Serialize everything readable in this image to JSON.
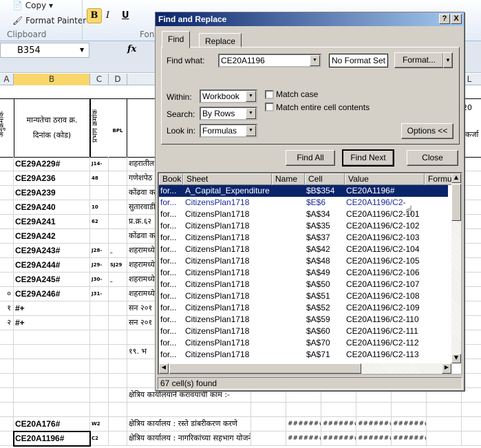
{
  "ribbon": {
    "copy": "Copy",
    "format_painter": "Format Painter",
    "clipboard_group": "Clipboard",
    "font_group": "Fon",
    "bold": "B",
    "italic": "I",
    "underline": "U"
  },
  "formula_bar": {
    "name_box": "B354",
    "fx": "fx"
  },
  "columns": [
    "A",
    "B",
    "C",
    "D"
  ],
  "header_row": {
    "col_a": "अनुक्रमांक",
    "col_b_line1": "मान्यतेचा ठराव क्र.",
    "col_b_line2": "दिनांक (कोड)",
    "col_c": "प्रभाग क्रमांक",
    "col_d": "BPL"
  },
  "rows": [
    {
      "a": "",
      "b": "CE29A229#",
      "c": "J14-",
      "d": "",
      "e": "शहरातील"
    },
    {
      "a": "",
      "b": "CE29A236",
      "c": "48",
      "d": "",
      "e": "गणेशपेठ"
    },
    {
      "a": "",
      "b": "CE29A239",
      "c": "",
      "d": "",
      "e": "कोंढवा क"
    },
    {
      "a": "",
      "b": "CE29A240",
      "c": "10",
      "d": "",
      "e": "सुतारवाडी"
    },
    {
      "a": "",
      "b": "CE29A241",
      "c": "62",
      "d": "",
      "e": "प्र.क्र.६२"
    },
    {
      "a": "",
      "b": "CE29A242",
      "c": "",
      "d": "",
      "e": "कोंढवा क"
    },
    {
      "a": "",
      "b": "CE29A243#",
      "c": "J28-",
      "d": "_",
      "e": "शहरामध्ये"
    },
    {
      "a": "",
      "b": "CE29A244#",
      "c": "J29-",
      "d": "SJ29",
      "e": "शहरामध्ये"
    },
    {
      "a": "",
      "b": "CE29A245#",
      "c": "J30-",
      "d": "_",
      "e": "शहरामध्ये"
    },
    {
      "a": "०",
      "b": "CE29A246#",
      "c": "J31-",
      "d": "",
      "e": "शहरामध्ये"
    },
    {
      "a": "१",
      "b": "#+",
      "c": "",
      "d": "",
      "e": "सन २०१"
    },
    {
      "a": "२",
      "b": "#+",
      "c": "",
      "d": "",
      "e": "सन २०१"
    },
    {
      "a": "",
      "b": "",
      "c": "",
      "d": "",
      "e": ""
    },
    {
      "a": "",
      "b": "",
      "c": "",
      "d": "",
      "e": "     १९. भ"
    },
    {
      "a": "",
      "b": "",
      "c": "",
      "d": "",
      "e": ""
    },
    {
      "a": "",
      "b": "",
      "c": "",
      "d": "",
      "e": ""
    },
    {
      "a": "",
      "b": "",
      "c": "",
      "d": "",
      "e": "क्षेत्रिय कार्यालयाने करावयाची कामं :-"
    },
    {
      "a": "",
      "b": "",
      "c": "",
      "d": "",
      "e": ""
    },
    {
      "a": "",
      "b": "CE20A176#",
      "c": "W2",
      "d": "",
      "e": "क्षेत्रिय कार्यालय : रस्ते डांबरीकरण करणे",
      "f": [
        "#######",
        "#######",
        "#######",
        "#######"
      ]
    },
    {
      "a": "",
      "b": "CE20A1196#",
      "c": "C2",
      "d": "",
      "e": "क्षेत्रिय कार्यालय : नागरिकांच्या सहभाग योजनेत",
      "f": [
        "#######",
        "#######",
        "#######",
        "#######"
      ]
    }
  ],
  "right_side": {
    "col_l": "L",
    "year": "20",
    "text": "कर्जा"
  },
  "dialog": {
    "title": "Find and Replace",
    "help": "?",
    "close_x": "X",
    "tabs": [
      "Find",
      "Replace"
    ],
    "find_what_label": "Find what:",
    "find_what_value": "CE20A1196",
    "format_preview": "No Format Set",
    "format_button": "Format...",
    "within_label": "Within:",
    "within_value": "Workbook",
    "search_label": "Search:",
    "search_value": "By Rows",
    "look_in_label": "Look in:",
    "look_in_value": "Formulas",
    "match_case": "Match case",
    "match_case_checked": false,
    "match_entire": "Match entire cell contents",
    "match_entire_checked": false,
    "options_button": "Options <<",
    "find_all": "Find All",
    "find_next": "Find Next",
    "close": "Close",
    "result_headers": [
      "Book",
      "Sheet",
      "Name",
      "Cell",
      "Value",
      "Formula"
    ],
    "results": [
      {
        "book": "for...",
        "sheet": "A_Capital_Expenditure",
        "name": "",
        "cell": "$B$354",
        "value": "CE20A1196#",
        "state": "selected"
      },
      {
        "book": "for...",
        "sheet": "CitizensPlan1718",
        "name": "",
        "cell": "$E$6",
        "value": "CE20A1196/C2-",
        "state": "hover"
      },
      {
        "book": "for...",
        "sheet": "CitizensPlan1718",
        "name": "",
        "cell": "$A$34",
        "value": "CE20A1196/C2-101"
      },
      {
        "book": "for...",
        "sheet": "CitizensPlan1718",
        "name": "",
        "cell": "$A$35",
        "value": "CE20A1196/C2-102"
      },
      {
        "book": "for...",
        "sheet": "CitizensPlan1718",
        "name": "",
        "cell": "$A$37",
        "value": "CE20A1196/C2-103"
      },
      {
        "book": "for...",
        "sheet": "CitizensPlan1718",
        "name": "",
        "cell": "$A$42",
        "value": "CE20A1196/C2-104"
      },
      {
        "book": "for...",
        "sheet": "CitizensPlan1718",
        "name": "",
        "cell": "$A$48",
        "value": "CE20A1196/C2-105"
      },
      {
        "book": "for...",
        "sheet": "CitizensPlan1718",
        "name": "",
        "cell": "$A$49",
        "value": "CE20A1196/C2-106"
      },
      {
        "book": "for...",
        "sheet": "CitizensPlan1718",
        "name": "",
        "cell": "$A$50",
        "value": "CE20A1196/C2-107"
      },
      {
        "book": "for...",
        "sheet": "CitizensPlan1718",
        "name": "",
        "cell": "$A$51",
        "value": "CE20A1196/C2-108"
      },
      {
        "book": "for...",
        "sheet": "CitizensPlan1718",
        "name": "",
        "cell": "$A$52",
        "value": "CE20A1196/C2-109"
      },
      {
        "book": "for...",
        "sheet": "CitizensPlan1718",
        "name": "",
        "cell": "$A$59",
        "value": "CE20A1196/C2-110"
      },
      {
        "book": "for...",
        "sheet": "CitizensPlan1718",
        "name": "",
        "cell": "$A$60",
        "value": "CE20A1196/C2-111"
      },
      {
        "book": "for...",
        "sheet": "CitizensPlan1718",
        "name": "",
        "cell": "$A$70",
        "value": "CE20A1196/C2-112"
      },
      {
        "book": "for...",
        "sheet": "CitizensPlan1718",
        "name": "",
        "cell": "$A$71",
        "value": "CE20A1196/C2-113"
      }
    ],
    "status": "67 cell(s) found"
  },
  "colors": {
    "title_start": "#0a246a",
    "title_end": "#a6caf0",
    "selected_row": "#0a246a",
    "dialog_bg": "#d4d0c8",
    "active_col": "#f8d66a"
  }
}
